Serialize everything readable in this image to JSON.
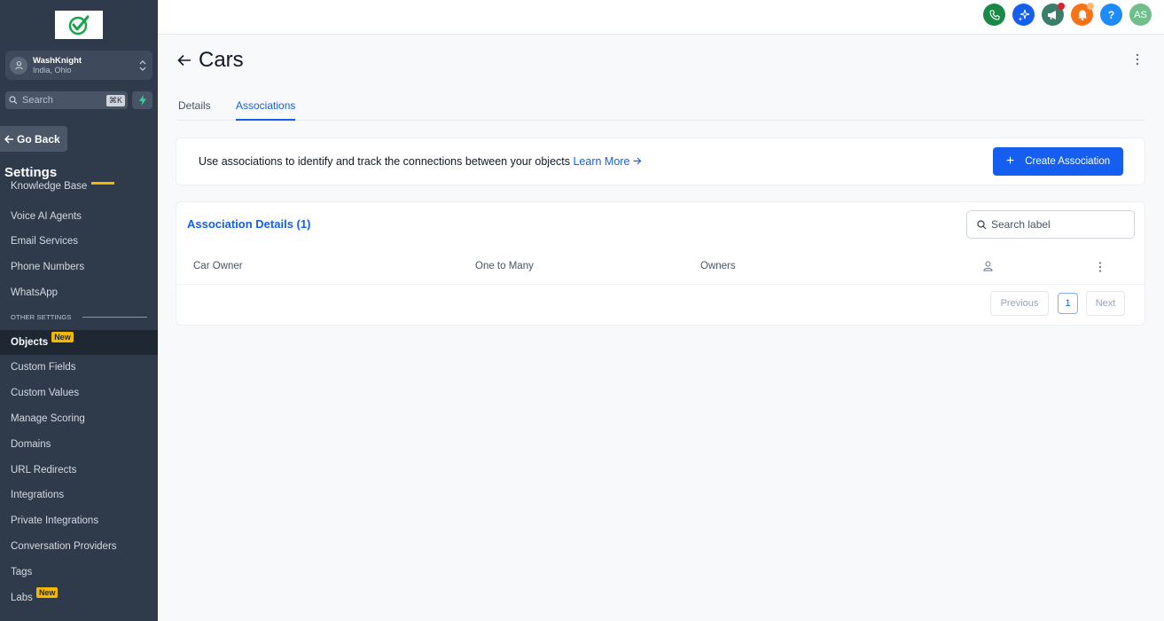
{
  "sidebar": {
    "account": {
      "name": "WashKnight",
      "location": "India, Ohio"
    },
    "search": {
      "placeholder": "Search",
      "shortcut": "⌘K"
    },
    "go_back": "Go Back",
    "settings_title": "Settings",
    "items_top": [
      "Knowledge Base",
      "Voice AI Agents",
      "Email Services",
      "Phone Numbers",
      "WhatsApp"
    ],
    "section_label": "OTHER SETTINGS",
    "items_other": [
      "Objects",
      "Custom Fields",
      "Custom Values",
      "Manage Scoring",
      "Domains",
      "URL Redirects",
      "Integrations",
      "Private Integrations",
      "Conversation Providers",
      "Tags",
      "Labs"
    ],
    "active_item": "Objects",
    "new_badge": "New"
  },
  "topbar": {
    "icons": [
      "phone-icon",
      "sparkle-icon",
      "megaphone-icon",
      "bell-icon",
      "help-icon"
    ],
    "help_glyph": "?",
    "avatar_initials": "AS",
    "colors": {
      "phone": "#188a45",
      "sparkle": "#155eef",
      "megaphone": "#3b7d6b",
      "bell": "#f97316",
      "help": "#1d8cf8",
      "avatar": "#6fbf8a"
    }
  },
  "page": {
    "title": "Cars",
    "tabs": [
      "Details",
      "Associations"
    ],
    "active_tab": "Associations"
  },
  "info": {
    "text": "Use associations to identify and track the connections between your objects",
    "learn_more": "Learn More",
    "create_button": "Create Association"
  },
  "associations": {
    "title": "Association Details (1)",
    "search_placeholder": "Search label",
    "rows": [
      {
        "name": "Car Owner",
        "type": "One to Many",
        "related": "Owners"
      }
    ],
    "pagination": {
      "previous": "Previous",
      "page": "1",
      "next": "Next"
    }
  },
  "colors": {
    "accent": "#155eef",
    "sidebar_bg": "#2f3a4a",
    "badge": "#f5b800"
  }
}
